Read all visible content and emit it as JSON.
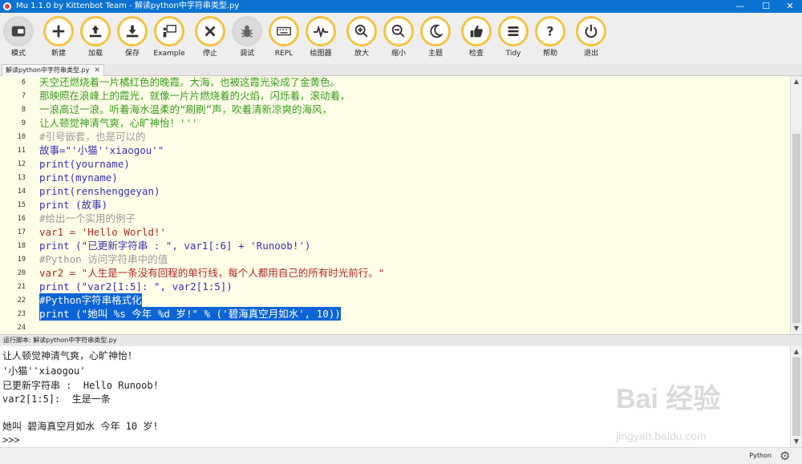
{
  "window": {
    "title": "Mu 1.1.0 by Kittenbot Team - 解读python中字符串类型.py",
    "minimize": "—",
    "maximize": "☐",
    "close": "✕"
  },
  "toolbar": {
    "accent": "#f5c242",
    "buttons": [
      {
        "label": "模式",
        "icon": "mode-icon"
      },
      {
        "label": "新建",
        "icon": "plus-icon"
      },
      {
        "label": "加载",
        "icon": "upload-icon"
      },
      {
        "label": "保存",
        "icon": "download-icon"
      },
      {
        "label": "Example",
        "icon": "teacher-icon"
      },
      {
        "label": "停止",
        "icon": "stop-icon"
      },
      {
        "label": "调试",
        "icon": "bug-icon"
      },
      {
        "label": "REPL",
        "icon": "keyboard-icon"
      },
      {
        "label": "绘图器",
        "icon": "plotter-icon"
      },
      {
        "label": "放大",
        "icon": "zoom-in-icon"
      },
      {
        "label": "缩小",
        "icon": "zoom-out-icon"
      },
      {
        "label": "主题",
        "icon": "moon-icon"
      },
      {
        "label": "检查",
        "icon": "thumbs-up-icon"
      },
      {
        "label": "Tidy",
        "icon": "tidy-icon"
      },
      {
        "label": "帮助",
        "icon": "help-icon"
      },
      {
        "label": "退出",
        "icon": "power-icon"
      }
    ]
  },
  "tab": {
    "label": "解读python中字符串类型.py",
    "close": "✕"
  },
  "editor": {
    "lines": [
      {
        "n": "6",
        "text": "天空还燃烧着一片橘红色的晚霞。大海，也被这霞光染成了金黄色。"
      },
      {
        "n": "7",
        "text": "那映照在浪峰上的霞光，就像一片片燃烧着的火焰，闪烁着，滚动着，"
      },
      {
        "n": "8",
        "text": "一浪高过一浪。听着海水温柔的“刷刷”声，吹着清新凉爽的海风，"
      },
      {
        "n": "9",
        "text": "让人顿觉神清气爽，心旷神怡！'''"
      },
      {
        "n": "10",
        "text": "#引号嵌套，也是可以的"
      },
      {
        "n": "11",
        "text": "故事=\"'小猫''xiaogou'\""
      },
      {
        "n": "12",
        "text": "print(yourname)"
      },
      {
        "n": "13",
        "text": "print(myname)"
      },
      {
        "n": "14",
        "text": "print(renshenggeyan)"
      },
      {
        "n": "15",
        "text": "print (故事)"
      },
      {
        "n": "16",
        "text": "#给出一个实用的例子"
      },
      {
        "n": "17",
        "text": "var1 = 'Hello World!'"
      },
      {
        "n": "18",
        "text": "print (\"已更新字符串 : \", var1[:6] + 'Runoob!')"
      },
      {
        "n": "19",
        "text": "#Python 访问字符串中的值"
      },
      {
        "n": "20",
        "text": "var2 = \"人生是一条没有回程的单行线，每个人都用自己的所有时光前行。\""
      },
      {
        "n": "21",
        "text": "print (\"var2[1:5]: \", var2[1:5])"
      },
      {
        "n": "22",
        "text": "#Python字符串格式化"
      },
      {
        "n": "23",
        "text": "print (\"她叫 %s 今年 %d 岁!\" % ('碧海真空月如水', 10))"
      },
      {
        "n": "24",
        "text": ""
      }
    ]
  },
  "run_panel": {
    "label": "运行脚本: 解读python中字符串类型.py",
    "output": [
      "让人顿觉神清气爽，心旷神怡！",
      "'小猫''xiaogou'",
      "已更新字符串 :  Hello Runoob!",
      "var2[1:5]:  生是一条",
      "",
      "她叫 碧海真空月如水 今年 10 岁!",
      ">>>"
    ]
  },
  "watermark": {
    "brand": "Bai 经验",
    "url": "jingyan.baidu.com"
  },
  "status": {
    "mode": "Python",
    "settings_icon": "gear-icon"
  }
}
